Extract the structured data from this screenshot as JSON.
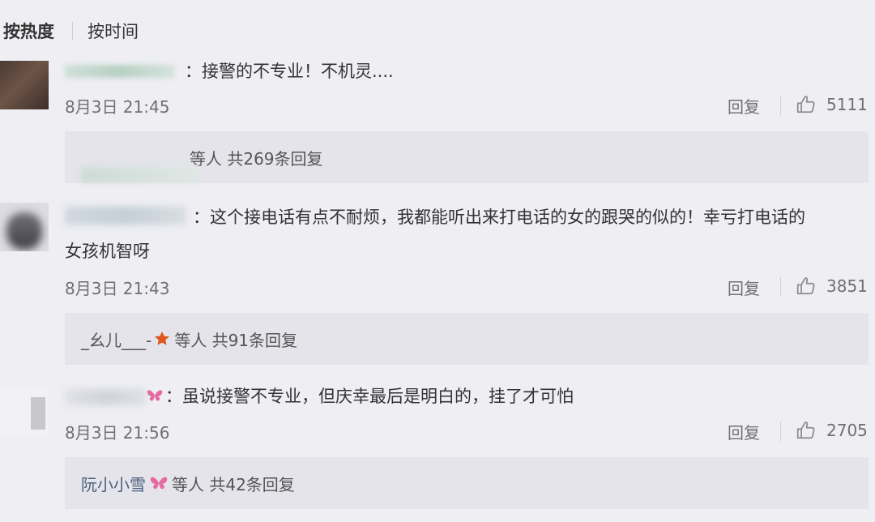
{
  "sort": {
    "hot": "按热度",
    "time": "按时间"
  },
  "comments": [
    {
      "text": "：接警的不专业！不机灵....",
      "time": "8月3日 21:45",
      "reply_label": "回复",
      "likes": "5111",
      "reply_summary": "等人 共269条回复"
    },
    {
      "text_line1": "：这个接电话有点不耐烦，我都能听出来打电话的女的跟哭的似的！幸亏打电话的",
      "text_line2": "女孩机智呀",
      "time": "8月3日 21:43",
      "reply_label": "回复",
      "likes": "3851",
      "reply_user": "_幺儿___-",
      "reply_summary": "等人 共91条回复"
    },
    {
      "text": "：虽说接警不专业，但庆幸最后是明白的，挂了才可怕",
      "time": "8月3日 21:56",
      "reply_label": "回复",
      "likes": "2705",
      "reply_user": "阮小小雪",
      "reply_summary": "等人 共42条回复"
    }
  ],
  "colors": {
    "page_bg": "#eeeef3",
    "reply_bg": "#e4e4ea",
    "link": "#4a5f7e",
    "star": "#e0561e",
    "butterfly": "#e56aa0"
  },
  "icons": {
    "like": "thumbs-up-icon",
    "star": "star-icon",
    "butterfly": "butterfly-icon"
  }
}
